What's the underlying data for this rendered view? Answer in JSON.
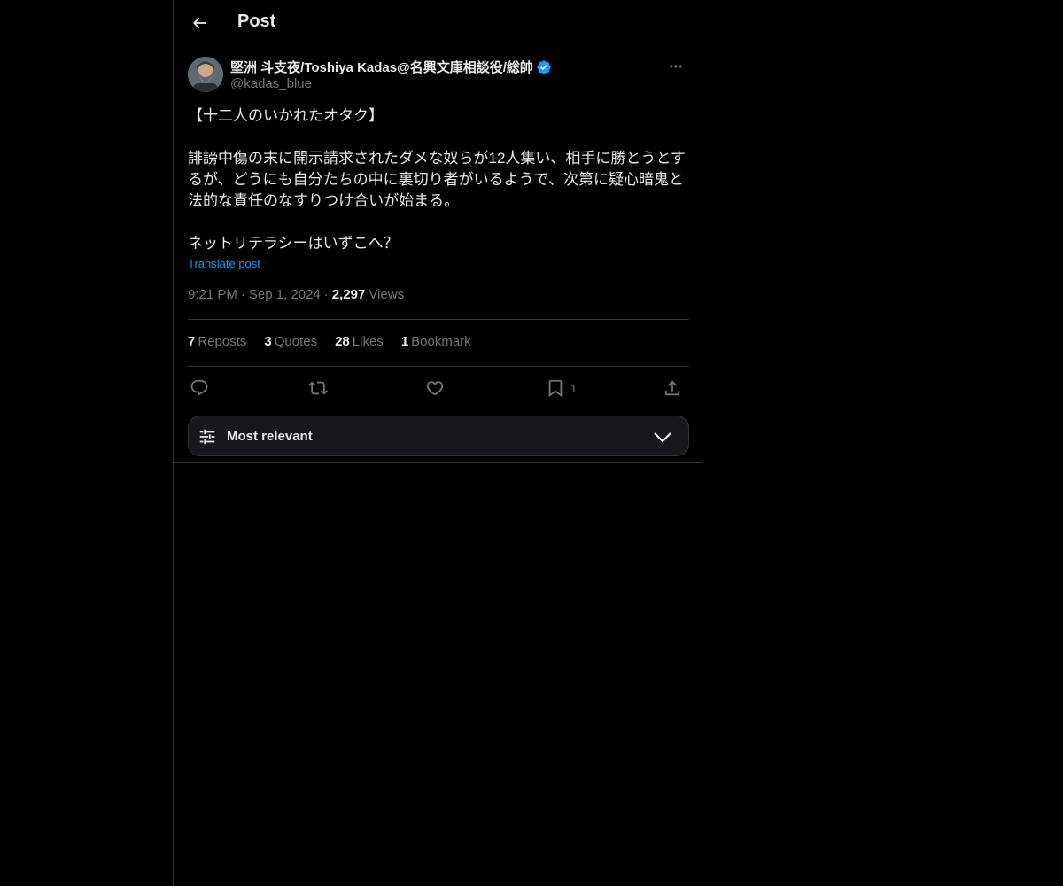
{
  "header": {
    "title": "Post",
    "back_icon": "arrow-left-icon"
  },
  "author": {
    "name": "堅洲 斗支夜/Toshiya Kadas@名興文庫相談役/総帥",
    "handle": "@kadas_blue",
    "verified": true,
    "verified_color": "#1d9bf0"
  },
  "tweet": {
    "text": "【十二人のいかれたオタク】\n\n誹謗中傷の末に開示請求されたダメな奴らが12人集い、相手に勝とうとするが、どうにも自分たちの中に裏切り者がいるようで、次第に疑心暗鬼と法的な責任のなすりつけ合いが始まる。\n\nネットリテラシーはいずこへ？",
    "translate_label": "Translate post"
  },
  "meta": {
    "time": "9:21 PM",
    "sep1": "·",
    "date": "Sep 1, 2024",
    "sep2": "·",
    "views_count": "2,297",
    "views_label": "Views"
  },
  "stats": {
    "reposts_count": "7",
    "reposts_label": "Reposts",
    "quotes_count": "3",
    "quotes_label": "Quotes",
    "likes_count": "28",
    "likes_label": "Likes",
    "bookmarks_count": "1",
    "bookmarks_label": "Bookmark"
  },
  "actions": {
    "reply_icon": "reply-icon",
    "repost_icon": "repost-icon",
    "like_icon": "heart-icon",
    "bookmark_icon": "bookmark-icon",
    "bookmark_count": "1",
    "share_icon": "share-icon"
  },
  "sort": {
    "label": "Most relevant"
  },
  "colors": {
    "background": "#000000",
    "text": "#e7e9ea",
    "muted": "#71767b",
    "accent": "#1d9bf0",
    "border": "#2f3336"
  }
}
